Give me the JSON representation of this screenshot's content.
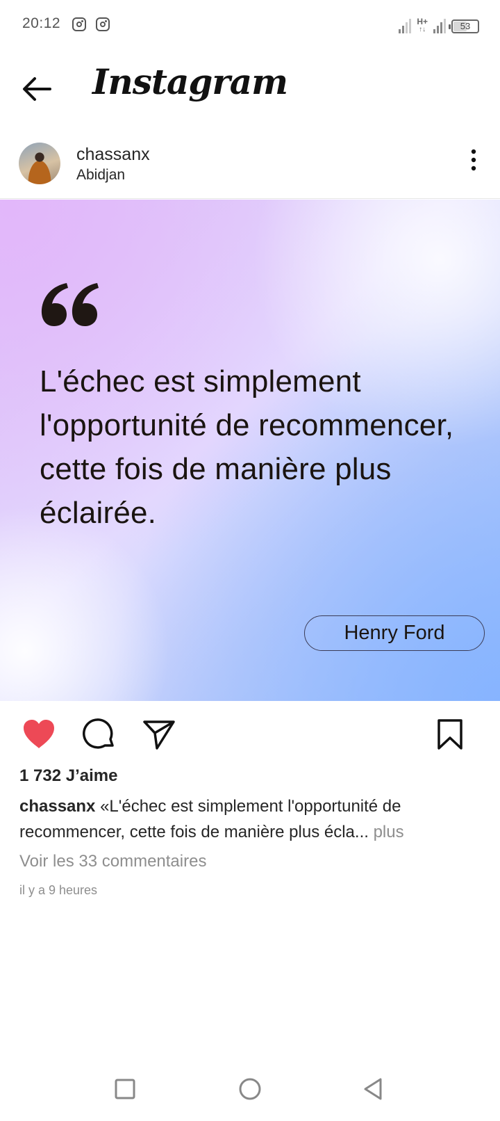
{
  "status_bar": {
    "time": "20:12",
    "network_type_top": "H+",
    "network_type_bottom": "↑↓",
    "battery": "53",
    "battery_level": 0.53
  },
  "header": {
    "app_name": "Instagram",
    "back_icon": "arrow-left-icon"
  },
  "post": {
    "username": "chassanx",
    "location": "Abidjan",
    "more_icon": "more-vertical-icon",
    "image": {
      "quote": "L'échec est simplement l'opportunité de recommencer, cette fois de manière plus éclairée.",
      "author": "Henry Ford",
      "colors": {
        "top_left": "#dcc4f8",
        "bottom_right": "#9ec0fb",
        "text": "#1a1410"
      }
    },
    "actions": {
      "like_icon": "heart-filled-icon",
      "like_color": "#ed4956",
      "comment_icon": "comment-icon",
      "share_icon": "send-icon",
      "save_icon": "bookmark-icon"
    },
    "likes": "1 732 J’aime",
    "caption_user": "chassanx",
    "caption_text": "«L'échec est simplement l'opportunité de recommencer, cette fois de manière plus écla...",
    "caption_more": " plus",
    "view_comments": "Voir les 33 commentaires",
    "time_ago": "il y a 9 heures"
  },
  "nav_bar": {
    "recents_icon": "square-icon",
    "home_icon": "circle-icon",
    "back_icon": "triangle-back-icon"
  }
}
